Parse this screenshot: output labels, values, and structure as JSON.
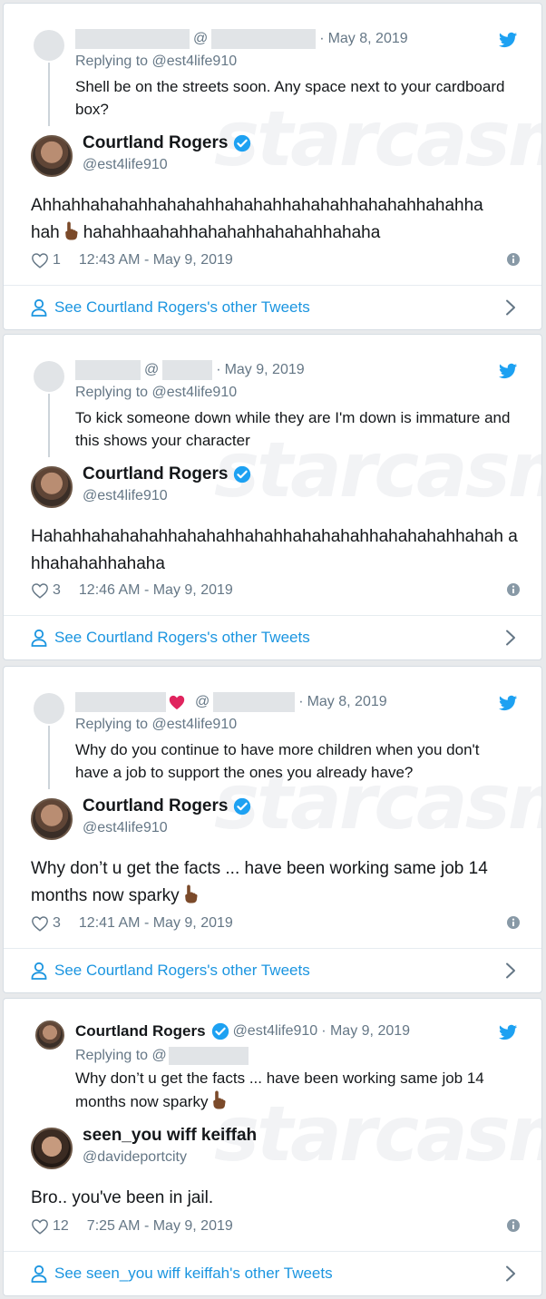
{
  "watermark": "starcasm",
  "tweets": [
    {
      "reply": {
        "at": "@",
        "date": "May 8, 2019",
        "replying_to": "Replying to @est4life910",
        "text": "Shell be on the streets soon. Any space next to your cardboard box?"
      },
      "author": {
        "name": "Courtland Rogers",
        "handle": "@est4life910"
      },
      "text_line1": "Ahhahhahahahhahahahhahahahhahahahhahahahhahahha",
      "text_line2_a": "hah",
      "text_line2_b": "hahahhaahahhahahahhahahahhahaha",
      "likes": "1",
      "timestamp": "12:43 AM - May 9, 2019",
      "see_more": "See Courtland Rogers's other Tweets"
    },
    {
      "reply": {
        "at": "@",
        "date": "May 9, 2019",
        "replying_to": "Replying to @est4life910",
        "text": "To kick someone down while they are I'm down is immature and this shows your character"
      },
      "author": {
        "name": "Courtland Rogers",
        "handle": "@est4life910"
      },
      "text": "Hahahhahahahahhahahahhahahhahahahahhahahahahhahah ahhahahahhahaha",
      "likes": "3",
      "timestamp": "12:46 AM - May 9, 2019",
      "see_more": "See Courtland Rogers's other Tweets"
    },
    {
      "reply": {
        "at": "@",
        "date": "May 8, 2019",
        "replying_to": "Replying to @est4life910",
        "text": "Why do you continue to have more children when you don't have a job to support the ones you already have?"
      },
      "author": {
        "name": "Courtland Rogers",
        "handle": "@est4life910"
      },
      "text": "Why don’t u get the facts ... have been working same job 14 months now sparky",
      "likes": "3",
      "timestamp": "12:41 AM - May 9, 2019",
      "see_more": "See Courtland Rogers's other Tweets"
    },
    {
      "reply": {
        "name": "Courtland Rogers",
        "handle": "@est4life910",
        "date": "· May 9, 2019",
        "replying_to": "Replying to @",
        "text": "Why don’t u get the facts ... have been working same job 14 months now sparky"
      },
      "author": {
        "name": "seen_you wiff keiffah",
        "handle": "@davideportcity"
      },
      "text": "Bro..  you've been in jail.",
      "likes": "12",
      "timestamp": "7:25 AM - May 9, 2019",
      "see_more": "See seen_you wiff keiffah's other Tweets"
    }
  ],
  "colors": {
    "twitter_blue": "#1da1f2",
    "link": "#1b95e0",
    "muted": "#657786",
    "heart_red": "#e0245e"
  },
  "icons": [
    "twitter-bird-icon",
    "verified-badge-icon",
    "heart-icon",
    "info-icon",
    "person-icon",
    "chevron-right-icon",
    "middle-finger-emoji"
  ]
}
